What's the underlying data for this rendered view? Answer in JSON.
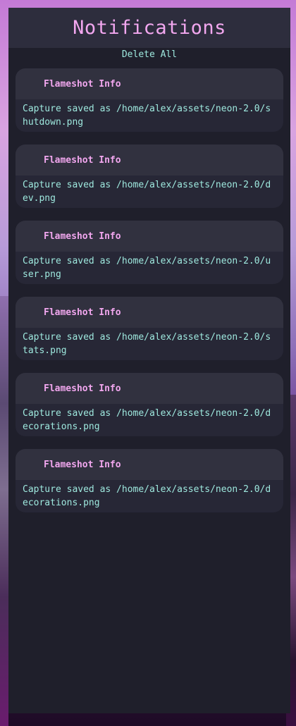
{
  "panel": {
    "title": "Notifications",
    "delete_all_label": "Delete All"
  },
  "notifications": [
    {
      "title": "Flameshot Info",
      "body": "Capture saved as /home/alex/assets/neon-2.0/shutdown.png"
    },
    {
      "title": "Flameshot Info",
      "body": "Capture saved as /home/alex/assets/neon-2.0/dev.png"
    },
    {
      "title": "Flameshot Info",
      "body": "Capture saved as /home/alex/assets/neon-2.0/user.png"
    },
    {
      "title": "Flameshot Info",
      "body": "Capture saved as /home/alex/assets/neon-2.0/stats.png"
    },
    {
      "title": "Flameshot Info",
      "body": "Capture saved as /home/alex/assets/neon-2.0/decorations.png"
    },
    {
      "title": "Flameshot Info",
      "body": "Capture saved as /home/alex/assets/neon-2.0/decorations.png"
    }
  ],
  "colors": {
    "accent_pink": "#f2a7ef",
    "accent_cyan": "#9ee8de",
    "panel_bg": "#1f1f2b",
    "card_bg": "#272736"
  }
}
